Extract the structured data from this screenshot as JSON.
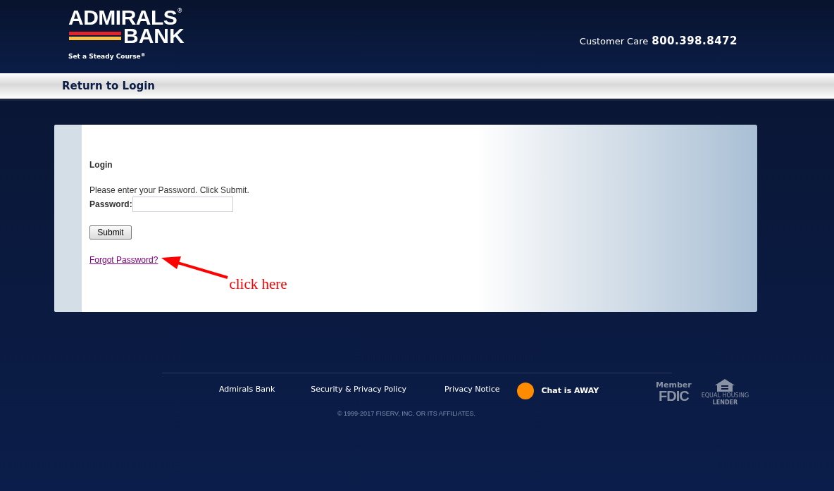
{
  "header": {
    "logo": {
      "line_1": "ADMIRALS",
      "mark": "®",
      "line_2": "BANK",
      "tagline": "Set a Steady Course$^{®}$"
    },
    "customer_care": {
      "label": "Customer Care",
      "phone": "800.398.8472"
    }
  },
  "nav_bar": {
    "link": "Return to Login"
  },
  "login": {
    "title": "Login",
    "instruction": "Please enter your Password. Click Submit.",
    "password_label": "Password:",
    "submit": "Submit",
    "forgot_link": "Forgot Password?",
    "annotation": "click here"
  },
  "footer": {
    "links": [
      "Admirals Bank",
      "Security & Privacy Policy",
      "Privacy Notice"
    ],
    "chat": {
      "label": "Chat is AWAY",
      "color": "#ff8c00"
    },
    "fdic": {
      "member": "Member",
      "name": "FDIC"
    },
    "housing": {
      "top": "EQUAL HOUSING",
      "bottom": "LENDER"
    },
    "copyright": "© 1999-2017 FISERV, INC. OR ITS AFFILIATES."
  }
}
